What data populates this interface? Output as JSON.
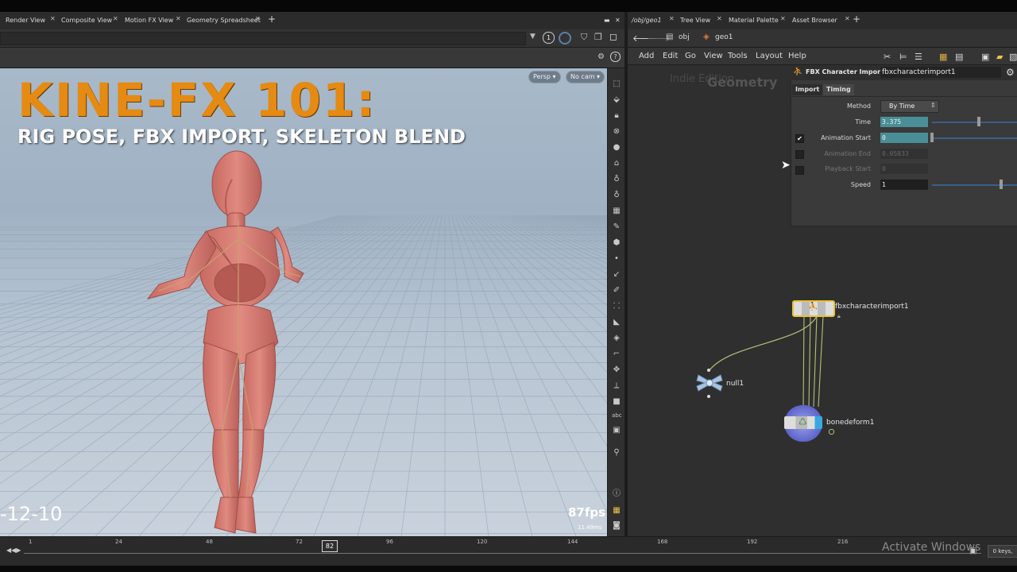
{
  "left_tabs": [
    "Render View",
    "Composite View",
    "Motion FX View",
    "Geometry Spreadsheet"
  ],
  "right_tabs": [
    "/obj/geo1",
    "Tree View",
    "Material Palette",
    "Asset Browser"
  ],
  "path": {
    "obj": "obj",
    "geo": "geo1"
  },
  "viewport": {
    "title": "KINE-FX 101:",
    "subtitle": "RIG POSE, FBX IMPORT, SKELETON BLEND",
    "persp": "Persp ▾",
    "cam": "No cam ▾",
    "frame_overlay": "-12-10",
    "fps": "87fps",
    "ms": "11.49ms",
    "toolbar_num": "1"
  },
  "menu": [
    "Add",
    "Edit",
    "Go",
    "View",
    "Tools",
    "Layout",
    "Help"
  ],
  "network": {
    "context_watermark": "Indie Edition",
    "context_label": "Geometry",
    "nodes": {
      "fbx": "fbxcharacterimport1",
      "null": "null1",
      "bone": "bonedeform1"
    }
  },
  "params": {
    "node_type": "FBX Character Import",
    "node_name": "fbxcharacterimport1",
    "tabs": [
      "Import",
      "Timing"
    ],
    "method_label": "Method",
    "method_value": "By Time",
    "time_label": "Time",
    "time_value": "3.375",
    "anim_start_label": "Animation Start",
    "anim_start_value": "0",
    "anim_end_label": "Animation End",
    "anim_end_value": "0.05833",
    "playback_start_label": "Playback Start",
    "playback_start_value": "0",
    "speed_label": "Speed",
    "speed_value": "1"
  },
  "timeline": {
    "ticks": [
      "1",
      "24",
      "48",
      "72",
      "96",
      "120",
      "144",
      "168",
      "192",
      "216"
    ],
    "current_frame": "82",
    "keys": "0 keys,",
    "watermark": "Activate Windows"
  }
}
